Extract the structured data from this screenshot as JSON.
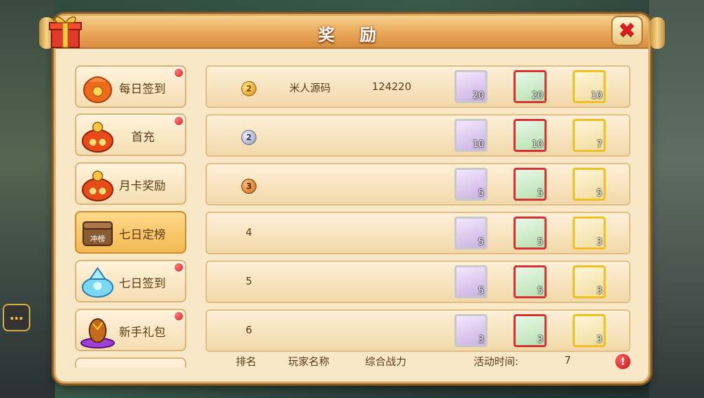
{
  "window": {
    "title": "奖 励"
  },
  "sidebar": {
    "items": [
      {
        "label": "每日签到",
        "badge": true,
        "icon": "red-envelope-icon"
      },
      {
        "label": "首充",
        "badge": true,
        "icon": "money-bag-icon"
      },
      {
        "label": "月卡奖励",
        "badge": false,
        "icon": "money-bag-icon"
      },
      {
        "label": "七日定榜",
        "badge": false,
        "icon": "ranking-chest-icon",
        "active": true,
        "icon_text": "冲榜"
      },
      {
        "label": "七日签到",
        "badge": true,
        "icon": "crystal-bag-icon"
      },
      {
        "label": "新手礼包",
        "badge": true,
        "icon": "egg-gift-icon"
      }
    ]
  },
  "rows": [
    {
      "rank": "2",
      "medal": "gold",
      "player": "米人源码",
      "power": "124220",
      "items": [
        "20",
        "20",
        "10"
      ]
    },
    {
      "rank": "2",
      "medal": "silver",
      "player": "",
      "power": "",
      "items": [
        "10",
        "10",
        "7"
      ]
    },
    {
      "rank": "3",
      "medal": "bronze",
      "player": "",
      "power": "",
      "items": [
        "5",
        "5",
        "5"
      ]
    },
    {
      "rank": "4",
      "medal": "",
      "player": "",
      "power": "",
      "items": [
        "5",
        "5",
        "3"
      ]
    },
    {
      "rank": "5",
      "medal": "",
      "player": "",
      "power": "",
      "items": [
        "5",
        "5",
        "3"
      ]
    },
    {
      "rank": "6",
      "medal": "",
      "player": "",
      "power": "",
      "items": [
        "3",
        "3",
        "3"
      ]
    }
  ],
  "footer": {
    "rank_label": "排名",
    "player_label": "玩家名称",
    "power_label": "综合战力",
    "time_label": "活动时间:",
    "time_value": "7",
    "info_icon": "!"
  },
  "colors": {
    "title_bar": "#e9a75a",
    "panel_bg": "#f8e8c8",
    "badge_red": "#e01818",
    "text_brown": "#5b3a14"
  }
}
